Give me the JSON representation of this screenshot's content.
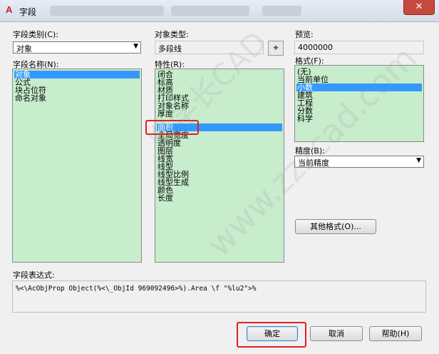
{
  "window": {
    "title": "字段",
    "close_glyph": "✕",
    "app_icon": "autocad-a-icon"
  },
  "field_category": {
    "label": "字段类别(C):",
    "value": "对象"
  },
  "field_names": {
    "label": "字段名称(N):",
    "items": [
      "对象",
      "公式",
      "块占位符",
      "命名对象"
    ],
    "selected_index": 0
  },
  "object_type": {
    "label": "对象类型:",
    "value": "多段线",
    "pick_icon": "crosshair-icon"
  },
  "properties": {
    "label": "特性(R):",
    "items": [
      "闭合",
      "标高",
      "材质",
      "打印样式",
      "对象名称",
      "厚度",
      "面积",
      "全局宽度",
      "透明度",
      "图层",
      "线宽",
      "线型",
      "线型比例",
      "线型生成",
      "颜色",
      "长度"
    ],
    "selected_index": 6
  },
  "preview": {
    "label": "预览:",
    "value": "4000000"
  },
  "format": {
    "label": "格式(F):",
    "items": [
      "(无)",
      "当前单位",
      "小数",
      "建筑",
      "工程",
      "分数",
      "科学"
    ],
    "selected_index": 2
  },
  "precision": {
    "label": "精度(B):",
    "value": "当前精度"
  },
  "other_format_button": "其他格式(O)...",
  "expression": {
    "label": "字段表达式:",
    "value": "%<\\AcObjProp Object(%<\\_ObjId 969092496>%).Area \\f \"%lu2\">%"
  },
  "buttons": {
    "ok": "确定",
    "cancel": "取消",
    "help": "帮助(H)"
  },
  "watermark": {
    "cn": "自学长CAD",
    "url": "www.zzzcad.com"
  },
  "colors": {
    "list_bg": "#c7edcc",
    "selection": "#3399ff",
    "highlight_box": "#e02020",
    "close": "#c74a3e"
  }
}
